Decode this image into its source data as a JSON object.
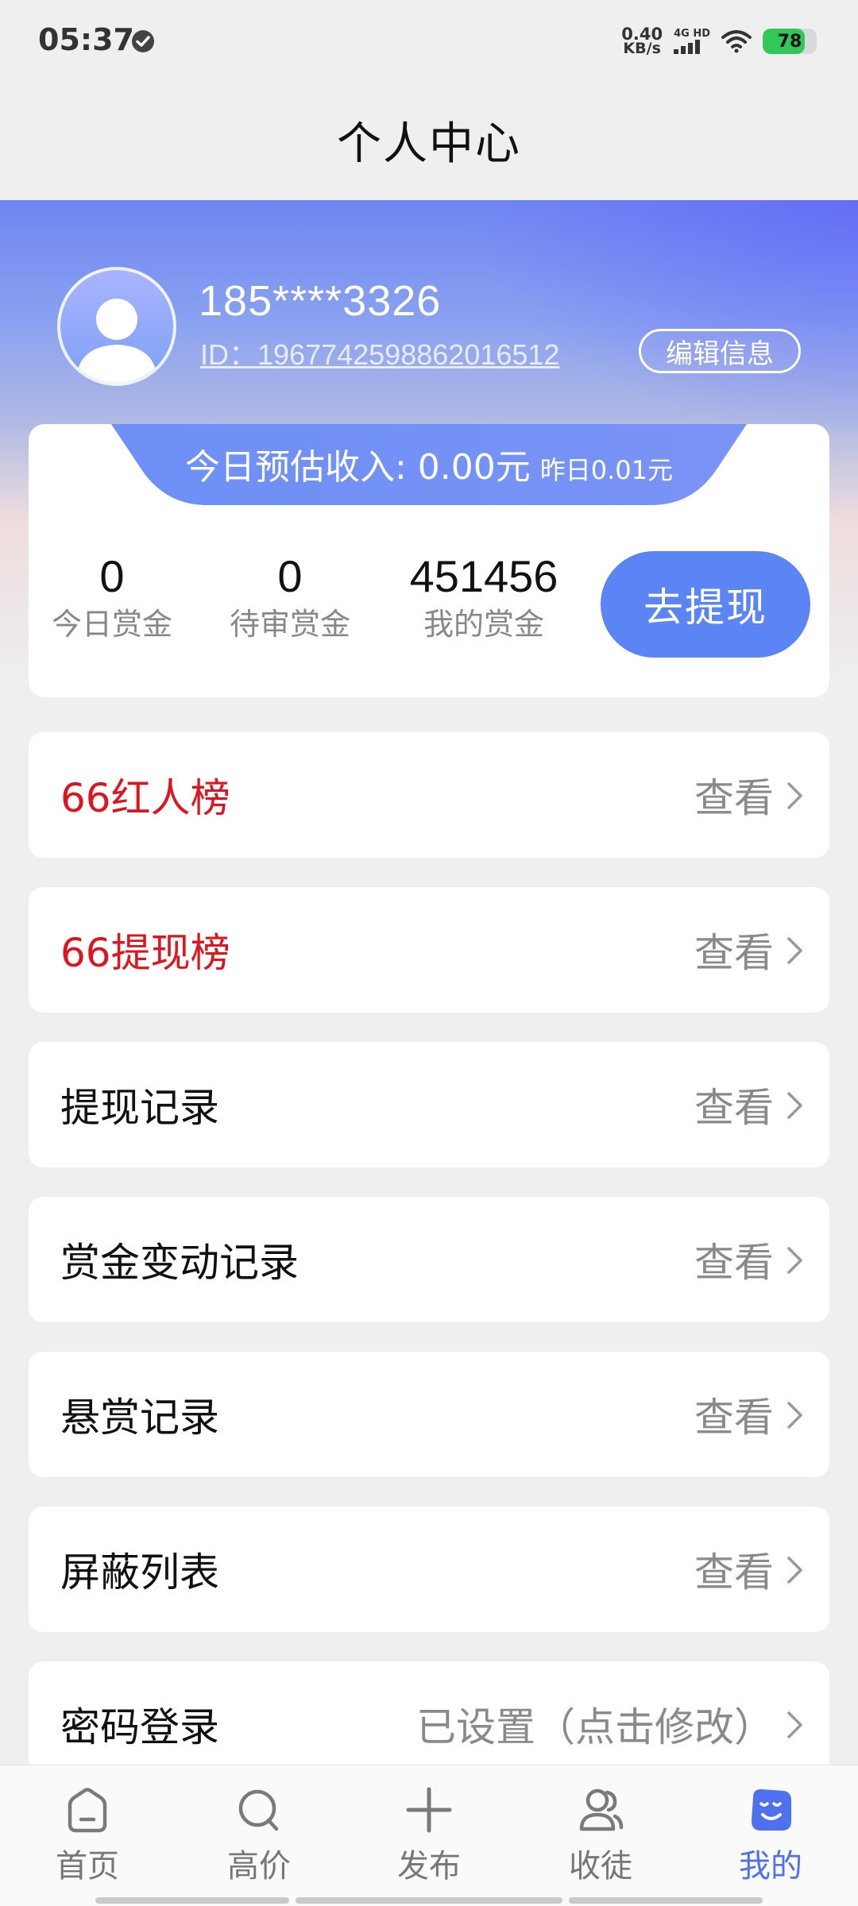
{
  "status_bar": {
    "time": "05:37",
    "net_speed_value": "0.40",
    "net_speed_unit": "KB/s",
    "net_type": "4G HD",
    "battery": "78",
    "battery_level": 0.78,
    "battery_color": "#33c759"
  },
  "header": {
    "title": "个人中心"
  },
  "profile": {
    "username": "185****3326",
    "user_id": "ID：1967742598862016512",
    "edit_label": "编辑信息"
  },
  "earnings": {
    "today_estimate": "今日预估收入: 0.00元",
    "yesterday": "昨日0.01元",
    "stats": [
      {
        "value": "0",
        "label": "今日赏金"
      },
      {
        "value": "0",
        "label": "待审赏金"
      },
      {
        "value": "451456",
        "label": "我的赏金"
      }
    ],
    "withdraw_label": "去提现"
  },
  "menu": {
    "items": [
      {
        "label": "66红人榜",
        "action": "查看",
        "highlight": true
      },
      {
        "label": "66提现榜",
        "action": "查看",
        "highlight": true
      },
      {
        "label": "提现记录",
        "action": "查看",
        "highlight": false
      },
      {
        "label": "赏金变动记录",
        "action": "查看",
        "highlight": false
      },
      {
        "label": "悬赏记录",
        "action": "查看",
        "highlight": false
      },
      {
        "label": "屏蔽列表",
        "action": "查看",
        "highlight": false
      },
      {
        "label": "密码登录",
        "action": "已设置（点击修改）",
        "highlight": false
      }
    ]
  },
  "tabs": [
    {
      "label": "首页",
      "icon": "home-icon"
    },
    {
      "label": "高价",
      "icon": "search-icon"
    },
    {
      "label": "发布",
      "icon": "plus-icon"
    },
    {
      "label": "收徒",
      "icon": "users-icon"
    },
    {
      "label": "我的",
      "icon": "smile-face-icon",
      "active": true
    }
  ],
  "colors": {
    "accent": "#5b84f5",
    "highlight_text": "#e0141e",
    "active_tab": "#4f71f0"
  }
}
